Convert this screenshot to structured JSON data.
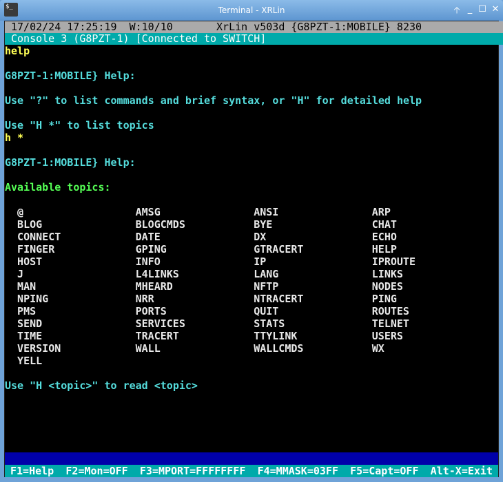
{
  "window": {
    "title": "Terminal - XRLin",
    "icon_text": "$_",
    "buttons": [
      "🡡",
      "_",
      "☐",
      "✕"
    ]
  },
  "status_bar": "17/02/24 17:25:19  W:10/10       XrLin v503d {G8PZT-1:MOBILE} 8230",
  "console_bar": "Console 3 (G8PZT-1) [Connected to SWITCH]",
  "lines": [
    {
      "row": 0,
      "text": "help",
      "color": "yellow"
    },
    {
      "row": 2,
      "text": "G8PZT-1:MOBILE} Help:",
      "color": "cyan"
    },
    {
      "row": 4,
      "text": "Use \"?\" to list commands and brief syntax, or \"H\" for detailed help",
      "color": "cyan"
    },
    {
      "row": 6,
      "text": "Use \"H *\" to list topics",
      "color": "cyan"
    },
    {
      "row": 7,
      "text": "h *",
      "color": "yellow"
    },
    {
      "row": 9,
      "text": "G8PZT-1:MOBILE} Help:",
      "color": "cyan"
    },
    {
      "row": 11,
      "text": "Available topics:",
      "color": "green"
    },
    {
      "row": 27,
      "text": "Use \"H <topic>\" to read <topic>",
      "color": "cyan"
    }
  ],
  "topics": [
    [
      "@",
      "AMSG",
      "ANSI",
      "ARP"
    ],
    [
      "BLOG",
      "BLOGCMDS",
      "BYE",
      "CHAT"
    ],
    [
      "CONNECT",
      "DATE",
      "DX",
      "ECHO"
    ],
    [
      "FINGER",
      "GPING",
      "GTRACERT",
      "HELP"
    ],
    [
      "HOST",
      "INFO",
      "IP",
      "IPROUTE"
    ],
    [
      "J",
      "L4LINKS",
      "LANG",
      "LINKS"
    ],
    [
      "MAN",
      "MHEARD",
      "NFTP",
      "NODES"
    ],
    [
      "NPING",
      "NRR",
      "NTRACERT",
      "PING"
    ],
    [
      "PMS",
      "PORTS",
      "QUIT",
      "ROUTES"
    ],
    [
      "SEND",
      "SERVICES",
      "STATS",
      "TELNET"
    ],
    [
      "TIME",
      "TRACERT",
      "TTYLINK",
      "USERS"
    ],
    [
      "VERSION",
      "WALL",
      "WALLCMDS",
      "WX"
    ],
    [
      "YELL"
    ]
  ],
  "function_keys": [
    "F1=Help",
    "F2=Mon=OFF",
    "F3=MPORT=FFFFFFFF",
    "F4=MMASK=03FF",
    "F5=Capt=OFF",
    "Alt-X=Exit"
  ],
  "colors": {
    "cyan": "#55dddd",
    "yellow": "#ffff55",
    "green": "#55ff55",
    "status_bg": "#aaaaaa",
    "console_bg": "#00aaaa",
    "blue_bar": "#0000aa"
  }
}
